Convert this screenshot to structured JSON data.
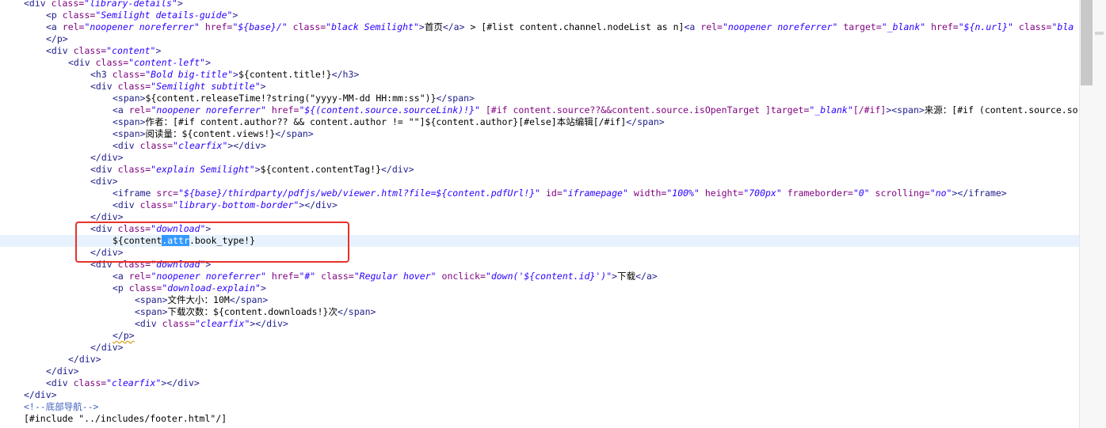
{
  "editor": {
    "lines": [
      {
        "indent": 2,
        "segments": [
          {
            "c": "tag",
            "t": "<div "
          },
          {
            "c": "attr",
            "t": "class="
          },
          {
            "c": "val",
            "t": "\"library-details\""
          },
          {
            "c": "tag",
            "t": ">"
          }
        ]
      },
      {
        "indent": 6,
        "segments": [
          {
            "c": "tag",
            "t": "<p "
          },
          {
            "c": "attr",
            "t": "class="
          },
          {
            "c": "val",
            "t": "\"Semilight details-guide\""
          },
          {
            "c": "tag",
            "t": ">"
          }
        ]
      },
      {
        "indent": 6,
        "segments": [
          {
            "c": "tag",
            "t": "<a "
          },
          {
            "c": "attr",
            "t": "rel="
          },
          {
            "c": "val",
            "t": "\"noopener noreferrer\""
          },
          {
            "c": "txt",
            "t": " "
          },
          {
            "c": "attr",
            "t": "href="
          },
          {
            "c": "val",
            "t": "\"${base}/\""
          },
          {
            "c": "txt",
            "t": " "
          },
          {
            "c": "attr",
            "t": "class="
          },
          {
            "c": "val",
            "t": "\"black Semilight\""
          },
          {
            "c": "tag",
            "t": ">"
          },
          {
            "c": "txt",
            "t": "首页"
          },
          {
            "c": "tag",
            "t": "</a>"
          },
          {
            "c": "txt",
            "t": " > [#list content.channel.nodeList as n]"
          },
          {
            "c": "tag",
            "t": "<a "
          },
          {
            "c": "attr",
            "t": "rel="
          },
          {
            "c": "val",
            "t": "\"noopener noreferrer\""
          },
          {
            "c": "txt",
            "t": " "
          },
          {
            "c": "attr",
            "t": "target="
          },
          {
            "c": "val",
            "t": "\"_blank\""
          },
          {
            "c": "txt",
            "t": " "
          },
          {
            "c": "attr",
            "t": "href="
          },
          {
            "c": "val",
            "t": "\"${n.url}\""
          },
          {
            "c": "txt",
            "t": " "
          },
          {
            "c": "attr",
            "t": "class="
          },
          {
            "c": "val",
            "t": "\"bla"
          }
        ]
      },
      {
        "indent": 6,
        "segments": [
          {
            "c": "tag",
            "t": "</p>"
          }
        ]
      },
      {
        "indent": 6,
        "segments": [
          {
            "c": "tag",
            "t": "<div "
          },
          {
            "c": "attr",
            "t": "class="
          },
          {
            "c": "val",
            "t": "\"content\""
          },
          {
            "c": "tag",
            "t": ">"
          }
        ]
      },
      {
        "indent": 10,
        "segments": [
          {
            "c": "tag",
            "t": "<div "
          },
          {
            "c": "attr",
            "t": "class="
          },
          {
            "c": "val",
            "t": "\"content-left\""
          },
          {
            "c": "tag",
            "t": ">"
          }
        ]
      },
      {
        "indent": 14,
        "segments": [
          {
            "c": "tag",
            "t": "<h3 "
          },
          {
            "c": "attr",
            "t": "class="
          },
          {
            "c": "val",
            "t": "\"Bold big-title\""
          },
          {
            "c": "tag",
            "t": ">"
          },
          {
            "c": "txt",
            "t": "${content.title!}"
          },
          {
            "c": "tag",
            "t": "</h3>"
          }
        ]
      },
      {
        "indent": 14,
        "segments": [
          {
            "c": "tag",
            "t": "<div "
          },
          {
            "c": "attr",
            "t": "class="
          },
          {
            "c": "val",
            "t": "\"Semilight subtitle\""
          },
          {
            "c": "tag",
            "t": ">"
          }
        ]
      },
      {
        "indent": 18,
        "segments": [
          {
            "c": "tag",
            "t": "<span>"
          },
          {
            "c": "txt",
            "t": "${content.releaseTime!?string(\"yyyy-MM-dd HH:mm:ss\")}"
          },
          {
            "c": "tag",
            "t": "</span>"
          }
        ]
      },
      {
        "indent": 18,
        "segments": [
          {
            "c": "tag",
            "t": "<a "
          },
          {
            "c": "attr",
            "t": "rel="
          },
          {
            "c": "val",
            "t": "\"noopener noreferrer\""
          },
          {
            "c": "txt",
            "t": " "
          },
          {
            "c": "attr",
            "t": "href="
          },
          {
            "c": "val",
            "t": "\"${(content.source.sourceLink)!}\""
          },
          {
            "c": "txt",
            "t": " "
          },
          {
            "c": "attr",
            "t": "[#if content.source??&&content.source.isOpenTarget ]target="
          },
          {
            "c": "val",
            "t": "\"_blank\""
          },
          {
            "c": "attr",
            "t": "[/#if]"
          },
          {
            "c": "tag",
            "t": ">"
          },
          {
            "c": "tag",
            "t": "<span>"
          },
          {
            "c": "txt",
            "t": "来源："
          },
          {
            "c": "txt",
            "t": "[#if (content.source.so"
          }
        ]
      },
      {
        "indent": 18,
        "segments": [
          {
            "c": "tag",
            "t": "<span>"
          },
          {
            "c": "txt",
            "t": "作者："
          },
          {
            "c": "txt",
            "t": "[#if content.author?? && content.author != \"\"]${content.author}[#else]本站编辑[/#if]"
          },
          {
            "c": "tag",
            "t": "</span>"
          }
        ]
      },
      {
        "indent": 18,
        "segments": [
          {
            "c": "tag",
            "t": "<span>"
          },
          {
            "c": "txt",
            "t": "阅读量："
          },
          {
            "c": "txt",
            "t": "${content.views!}"
          },
          {
            "c": "tag",
            "t": "</span>"
          }
        ]
      },
      {
        "indent": 18,
        "segments": [
          {
            "c": "tag",
            "t": "<div "
          },
          {
            "c": "attr",
            "t": "class="
          },
          {
            "c": "val",
            "t": "\"clearfix\""
          },
          {
            "c": "tag",
            "t": "></div>"
          }
        ]
      },
      {
        "indent": 14,
        "segments": [
          {
            "c": "tag",
            "t": "</div>"
          }
        ]
      },
      {
        "indent": 14,
        "segments": [
          {
            "c": "tag",
            "t": "<div "
          },
          {
            "c": "attr",
            "t": "class="
          },
          {
            "c": "val",
            "t": "\"explain Semilight\""
          },
          {
            "c": "tag",
            "t": ">"
          },
          {
            "c": "txt",
            "t": "${content.contentTag!}"
          },
          {
            "c": "tag",
            "t": "</div>"
          }
        ]
      },
      {
        "indent": 14,
        "segments": [
          {
            "c": "tag",
            "t": "<div>"
          }
        ]
      },
      {
        "indent": 18,
        "segments": [
          {
            "c": "tag",
            "t": "<iframe "
          },
          {
            "c": "attr",
            "t": "src="
          },
          {
            "c": "val",
            "t": "\"${base}/thirdparty/pdfjs/web/viewer.html?file=${content.pdfUrl!}\""
          },
          {
            "c": "txt",
            "t": " "
          },
          {
            "c": "attr",
            "t": "id="
          },
          {
            "c": "val",
            "t": "\"iframepage\""
          },
          {
            "c": "txt",
            "t": " "
          },
          {
            "c": "attr",
            "t": "width="
          },
          {
            "c": "val",
            "t": "\"100%\""
          },
          {
            "c": "txt",
            "t": " "
          },
          {
            "c": "attr",
            "t": "height="
          },
          {
            "c": "val",
            "t": "\"700px\""
          },
          {
            "c": "txt",
            "t": " "
          },
          {
            "c": "attr",
            "t": "frameborder="
          },
          {
            "c": "val",
            "t": "\"0\""
          },
          {
            "c": "txt",
            "t": " "
          },
          {
            "c": "attr",
            "t": "scrolling="
          },
          {
            "c": "val",
            "t": "\"no\""
          },
          {
            "c": "tag",
            "t": "></iframe>"
          }
        ]
      },
      {
        "indent": 18,
        "segments": [
          {
            "c": "tag",
            "t": "<div "
          },
          {
            "c": "attr",
            "t": "class="
          },
          {
            "c": "val",
            "t": "\"library-bottom-border\""
          },
          {
            "c": "tag",
            "t": "></div>"
          }
        ]
      },
      {
        "indent": 14,
        "segments": [
          {
            "c": "tag",
            "t": "</div>"
          }
        ]
      },
      {
        "indent": 14,
        "segments": [
          {
            "c": "tag",
            "t": "<div "
          },
          {
            "c": "attr",
            "t": "class="
          },
          {
            "c": "val",
            "t": "\"download\""
          },
          {
            "c": "tag",
            "t": ">"
          }
        ]
      },
      {
        "indent": 18,
        "current": true,
        "segments": [
          {
            "c": "txt",
            "t": "${content"
          },
          {
            "c": "sel",
            "t": ".attr"
          },
          {
            "c": "txt",
            "t": ".book_type!}"
          }
        ]
      },
      {
        "indent": 14,
        "segments": [
          {
            "c": "tag",
            "t": "</div>"
          }
        ]
      },
      {
        "indent": 14,
        "segments": [
          {
            "c": "tag",
            "t": "<div "
          },
          {
            "c": "attr",
            "t": "class="
          },
          {
            "c": "val",
            "t": "\"download\""
          },
          {
            "c": "tag",
            "t": ">"
          }
        ]
      },
      {
        "indent": 18,
        "segments": [
          {
            "c": "tag",
            "t": "<a "
          },
          {
            "c": "attr",
            "t": "rel="
          },
          {
            "c": "val",
            "t": "\"noopener noreferrer\""
          },
          {
            "c": "txt",
            "t": " "
          },
          {
            "c": "attr",
            "t": "href="
          },
          {
            "c": "val",
            "t": "\"#\""
          },
          {
            "c": "txt",
            "t": " "
          },
          {
            "c": "attr",
            "t": "class="
          },
          {
            "c": "val",
            "t": "\"Regular hover\""
          },
          {
            "c": "txt",
            "t": " "
          },
          {
            "c": "attr",
            "t": "onclick="
          },
          {
            "c": "val",
            "t": "\"down('${content.id}')\""
          },
          {
            "c": "tag",
            "t": ">"
          },
          {
            "c": "txt",
            "t": "下载"
          },
          {
            "c": "tag",
            "t": "</a>"
          }
        ]
      },
      {
        "indent": 18,
        "segments": [
          {
            "c": "tag",
            "t": "<p "
          },
          {
            "c": "attr",
            "t": "class="
          },
          {
            "c": "val",
            "t": "\"download-explain\""
          },
          {
            "c": "tag",
            "t": ">"
          }
        ]
      },
      {
        "indent": 22,
        "segments": [
          {
            "c": "tag",
            "t": "<span>"
          },
          {
            "c": "txt",
            "t": "文件大小："
          },
          {
            "c": "txt",
            "t": "10M"
          },
          {
            "c": "tag",
            "t": "</span>"
          }
        ]
      },
      {
        "indent": 22,
        "segments": [
          {
            "c": "tag",
            "t": "<span>"
          },
          {
            "c": "txt",
            "t": "下载次数："
          },
          {
            "c": "txt",
            "t": "${content.downloads!}次"
          },
          {
            "c": "tag",
            "t": "</span>"
          }
        ]
      },
      {
        "indent": 22,
        "segments": [
          {
            "c": "tag",
            "t": "<div "
          },
          {
            "c": "attr",
            "t": "class="
          },
          {
            "c": "val",
            "t": "\"clearfix\""
          },
          {
            "c": "tag",
            "t": "></div>"
          }
        ]
      },
      {
        "indent": 18,
        "segments": [
          {
            "c": "tagsq",
            "t": "</p>"
          }
        ]
      },
      {
        "indent": 14,
        "segments": [
          {
            "c": "tag",
            "t": "</div>"
          }
        ]
      },
      {
        "indent": 10,
        "segments": [
          {
            "c": "tag",
            "t": "</div>"
          }
        ]
      },
      {
        "indent": 6,
        "segments": [
          {
            "c": "tag",
            "t": "</div>"
          }
        ]
      },
      {
        "indent": 6,
        "segments": [
          {
            "c": "tag",
            "t": "<div "
          },
          {
            "c": "attr",
            "t": "class="
          },
          {
            "c": "val",
            "t": "\"clearfix\""
          },
          {
            "c": "tag",
            "t": "></div>"
          }
        ]
      },
      {
        "indent": 2,
        "segments": [
          {
            "c": "tag",
            "t": "</div>"
          }
        ]
      },
      {
        "indent": 2,
        "segments": [
          {
            "c": "com",
            "t": "<!--底部导航-->"
          }
        ]
      },
      {
        "indent": 2,
        "segments": [
          {
            "c": "txt",
            "t": "[#include \"../includes/footer.html\"/]"
          }
        ]
      }
    ]
  },
  "colors": {
    "tag": "#1e1e8c",
    "attribute": "#7f007f",
    "value": "#2a00ff",
    "comment": "#3f5fbf",
    "selection": "#3399ff",
    "current_line": "#e8f2fe",
    "highlight_box": "#e8322a"
  },
  "scrollbar": {
    "position_fraction": 0.0
  }
}
